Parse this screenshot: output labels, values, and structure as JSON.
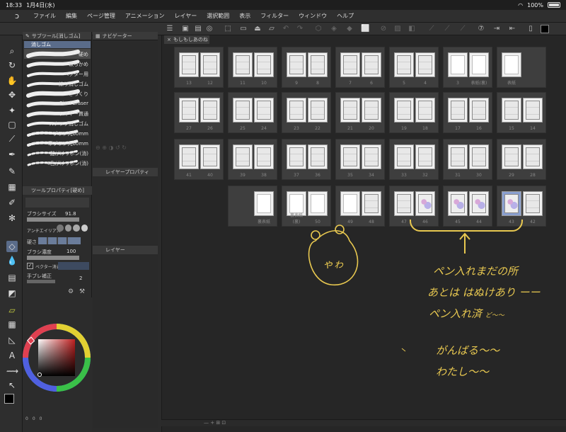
{
  "status": {
    "time": "18:33",
    "date": "1月4日(水)",
    "battery": "100%"
  },
  "menu": {
    "items": [
      "ファイル",
      "編集",
      "ページ管理",
      "アニメーション",
      "レイヤー",
      "選択範囲",
      "表示",
      "フィルター",
      "ウィンドウ",
      "ヘルプ"
    ]
  },
  "panels": {
    "subtool_title": "サブツール[消しゴム]",
    "subtool_group": "消しゴム",
    "navigator_title": "ナビゲーター",
    "tool_property_title": "ツールプロパティ[硬め]",
    "layer_property_title": "レイヤープロパティ",
    "layer_title": "レイヤー"
  },
  "brushes": [
    {
      "name": "硬め"
    },
    {
      "name": "軟らかめ"
    },
    {
      "name": "ベクター用"
    },
    {
      "name": "練り消しゴム"
    },
    {
      "name": "ざっくり"
    },
    {
      "name": "Pixel Eraser"
    },
    {
      "name": "レイヤー貫通"
    },
    {
      "name": "スナップ消しゴム"
    },
    {
      "name": "ブラシ丸60mm"
    },
    {
      "name": "筆ブラシ丸60mm"
    },
    {
      "name": "鎧がけリボン(消)"
    },
    {
      "name": "4色がけリボン(消)"
    }
  ],
  "tool_property": {
    "brush_size_label": "ブラシサイズ",
    "brush_size_value": "91.8",
    "antialias_label": "アンチエイリアス",
    "hardness_label": "硬さ",
    "brush_density_label": "ブラシ濃度",
    "brush_density_value": "100",
    "vector_eraser_label": "ベクター消去",
    "stabilization_label": "手ブレ補正",
    "stabilization_value": "2"
  },
  "document": {
    "tab_label": "もしもしあのね"
  },
  "spreads": [
    {
      "pages": [
        "13",
        "12"
      ]
    },
    {
      "pages": [
        "11",
        "10"
      ]
    },
    {
      "pages": [
        "9",
        "8"
      ]
    },
    {
      "pages": [
        "7",
        "6"
      ]
    },
    {
      "pages": [
        "5",
        "4"
      ]
    },
    {
      "pages": [
        "3",
        "表紙(裏)"
      ]
    },
    {
      "pages": [
        "表紙"
      ]
    },
    {
      "pages": [
        "27",
        "26"
      ]
    },
    {
      "pages": [
        "25",
        "24"
      ]
    },
    {
      "pages": [
        "23",
        "22"
      ]
    },
    {
      "pages": [
        "21",
        "20"
      ]
    },
    {
      "pages": [
        "19",
        "18"
      ]
    },
    {
      "pages": [
        "17",
        "16"
      ]
    },
    {
      "pages": [
        "15",
        "14"
      ]
    },
    {
      "pages": [
        "41",
        "40"
      ]
    },
    {
      "pages": [
        "39",
        "38"
      ]
    },
    {
      "pages": [
        "37",
        "36"
      ]
    },
    {
      "pages": [
        "35",
        "34"
      ]
    },
    {
      "pages": [
        "33",
        "32"
      ]
    },
    {
      "pages": [
        "31",
        "30"
      ]
    },
    {
      "pages": [
        "29",
        "28"
      ]
    },
    {
      "pages": [
        "裏表紙"
      ]
    },
    {
      "pages": [
        "裏表紙(裏)",
        "50"
      ]
    },
    {
      "pages": [
        "49",
        "48"
      ]
    },
    {
      "pages": [
        "47",
        "46"
      ]
    },
    {
      "pages": [
        "45",
        "44"
      ]
    },
    {
      "pages": [
        "43",
        "42"
      ]
    }
  ],
  "annotations": {
    "bear_text": "ゃゎ",
    "line1": "ペン入れまだの所",
    "line2": "あとは はぬけあり ーー",
    "line3": "ペン入れ済",
    "line3_suffix": "ど〜〜",
    "line4": "がんばる〜〜",
    "line5": "わたし〜〜"
  },
  "colors": {
    "accent": "#5a6c8a",
    "annotation": "#e8c850",
    "main_color": "#000000",
    "sub_color": "#ffffff"
  },
  "color_values": {
    "r": "0",
    "g": "0",
    "b": "0"
  }
}
